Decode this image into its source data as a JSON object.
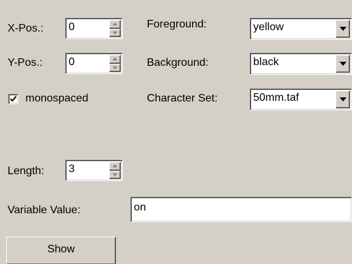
{
  "xpos": {
    "label": "X-Pos.:",
    "value": "0"
  },
  "ypos": {
    "label": "Y-Pos.:",
    "value": "0"
  },
  "monospaced": {
    "label": "monospaced",
    "checked": true
  },
  "foreground": {
    "label": "Foreground:",
    "value": "yellow"
  },
  "background": {
    "label": "Background:",
    "value": "black"
  },
  "charset": {
    "label": "Character Set:",
    "value": "50mm.taf"
  },
  "length": {
    "label": "Length:",
    "value": "3"
  },
  "variable_value": {
    "label": "Variable Value:",
    "value": "on"
  },
  "show_button": {
    "label": "Show"
  },
  "icons": {
    "spinner_up": "triangle-up-icon",
    "spinner_down": "triangle-down-icon",
    "dropdown": "chevron-down-icon",
    "checkmark": "checkmark-icon"
  }
}
